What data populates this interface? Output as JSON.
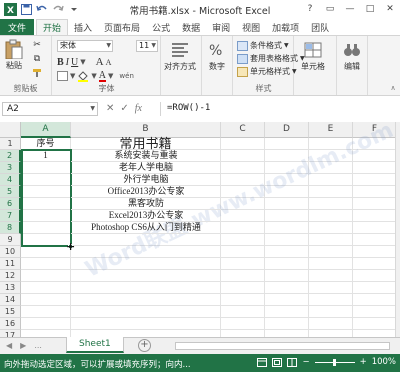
{
  "title_bar": {
    "title": "常用书籍.xlsx - Microsoft Excel",
    "qat": [
      "save-icon",
      "undo-icon",
      "redo-icon",
      "customize-icon"
    ],
    "window_controls": [
      "?",
      "▭",
      "—",
      "□",
      "✕"
    ]
  },
  "ribbon_tabs": {
    "file": "文件",
    "tabs": [
      "开始",
      "插入",
      "页面布局",
      "公式",
      "数据",
      "审阅",
      "视图",
      "加载项",
      "团队"
    ],
    "active": "开始"
  },
  "ribbon": {
    "clipboard": {
      "paste": "粘贴",
      "label": "剪贴板"
    },
    "font": {
      "font_name": "宋体",
      "font_size": "11",
      "bold": "B",
      "italic": "I",
      "underline": "U",
      "grow": "A",
      "shrink": "A",
      "label": "字体",
      "wen": "wén"
    },
    "alignment": {
      "button": "对齐方式"
    },
    "number": {
      "button": "数字"
    },
    "styles": {
      "conditional": "条件格式",
      "table": "套用表格格式",
      "cell_styles": "单元格样式",
      "label": "样式"
    },
    "cells": {
      "button": "单元格"
    },
    "editing": {
      "button": "编辑"
    }
  },
  "formula_bar": {
    "name_box": "A2",
    "formula": "=ROW()-1",
    "icons": [
      "✕",
      "✓",
      "fx"
    ]
  },
  "sheet": {
    "columns": [
      "A",
      "B",
      "C",
      "D",
      "E",
      "F"
    ],
    "rows": [
      "1",
      "2",
      "3",
      "4",
      "5",
      "6",
      "7",
      "8",
      "9",
      "10",
      "11",
      "12",
      "13",
      "14",
      "15",
      "16",
      "17"
    ],
    "header_A1": "序号",
    "title_B1": "常用书籍",
    "A2": "1",
    "books": [
      "系统安装与重装",
      "老年人学电脑",
      "外行学电脑",
      "Office2013办公专家",
      "黑客攻防",
      "Excel2013办公专家",
      "Photoshop CS6从入门到精通"
    ]
  },
  "sheet_tabs": {
    "active": "Sheet1",
    "add": "+",
    "nav": [
      "◀",
      "▶",
      "..."
    ]
  },
  "status_bar": {
    "message": "向外拖动选定区域，可以扩展或填充序列；向内...",
    "zoom": "100%",
    "minus": "−",
    "plus": "+"
  },
  "watermark": "Word联盟 www.wordlm.com",
  "colors": {
    "accent": "#217346",
    "selection_header": "#d3e7da"
  }
}
